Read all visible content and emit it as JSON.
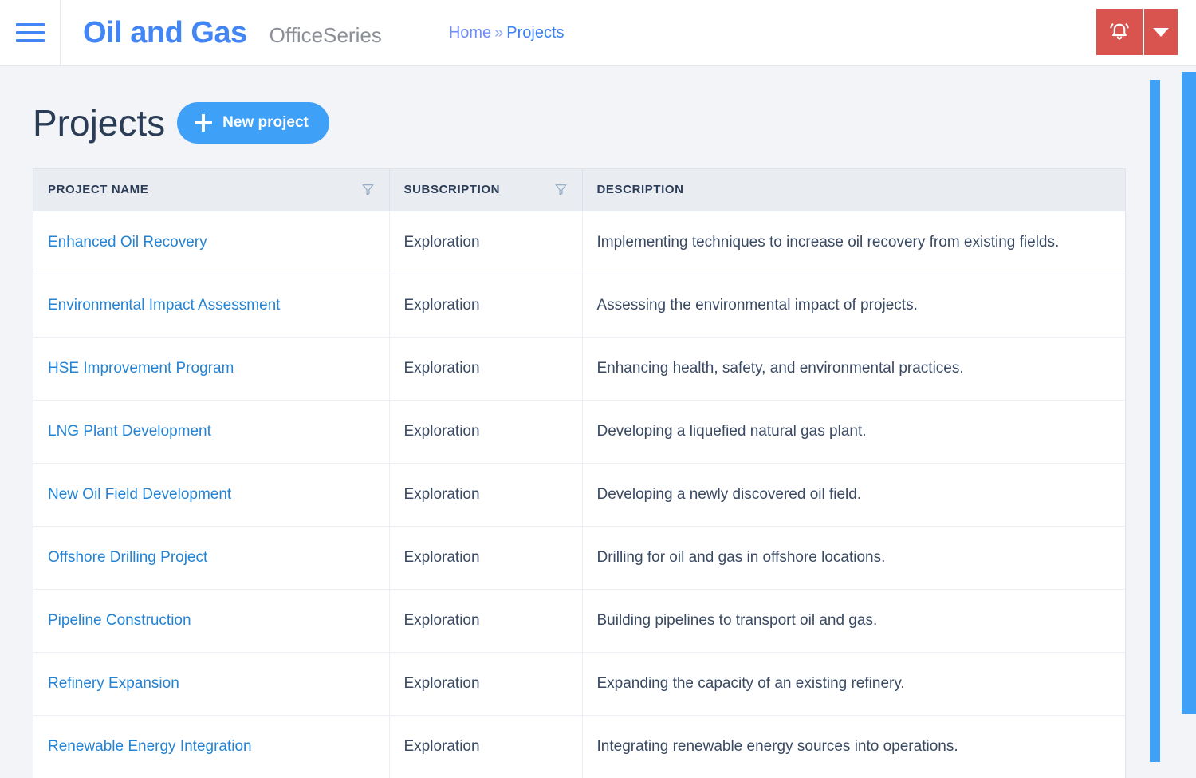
{
  "topbar": {
    "menu_icon": "hamburger-menu-icon",
    "brand": "Oil and Gas",
    "brand_sub": "OfficeSeries",
    "breadcrumb": {
      "home": "Home",
      "separator": "»",
      "current": "Projects"
    },
    "notification_icon": "bell-icon",
    "dropdown_icon": "caret-down-icon",
    "accent_red": "#d9534f",
    "accent_blue": "#4285f4"
  },
  "main": {
    "title": "Projects",
    "new_button_label": "New project",
    "new_button_icon": "plus-icon",
    "new_button_color": "#3fa0f7"
  },
  "table": {
    "columns": [
      {
        "label": "PROJECT NAME",
        "filter": true,
        "filter_icon": "filter-funnel-icon"
      },
      {
        "label": "SUBSCRIPTION",
        "filter": true,
        "filter_icon": "filter-funnel-icon"
      },
      {
        "label": "DESCRIPTION",
        "filter": false,
        "filter_icon": ""
      }
    ],
    "rows": [
      {
        "name": "Enhanced Oil Recovery",
        "subscription": "Exploration",
        "description": "Implementing techniques to increase oil recovery from existing fields."
      },
      {
        "name": "Environmental Impact Assessment",
        "subscription": "Exploration",
        "description": "Assessing the environmental impact of projects."
      },
      {
        "name": "HSE Improvement Program",
        "subscription": "Exploration",
        "description": "Enhancing health, safety, and environmental practices."
      },
      {
        "name": "LNG Plant Development",
        "subscription": "Exploration",
        "description": "Developing a liquefied natural gas plant."
      },
      {
        "name": "New Oil Field Development",
        "subscription": "Exploration",
        "description": "Developing a newly discovered oil field."
      },
      {
        "name": "Offshore Drilling Project",
        "subscription": "Exploration",
        "description": "Drilling for oil and gas in offshore locations."
      },
      {
        "name": "Pipeline Construction",
        "subscription": "Exploration",
        "description": "Building pipelines to transport oil and gas."
      },
      {
        "name": "Refinery Expansion",
        "subscription": "Exploration",
        "description": "Expanding the capacity of an existing refinery."
      },
      {
        "name": "Renewable Energy Integration",
        "subscription": "Exploration",
        "description": "Integrating renewable energy sources into operations."
      }
    ]
  },
  "scrollbars": {
    "inner_color": "#3fa0f7",
    "outer_color": "#3fa0f7"
  }
}
